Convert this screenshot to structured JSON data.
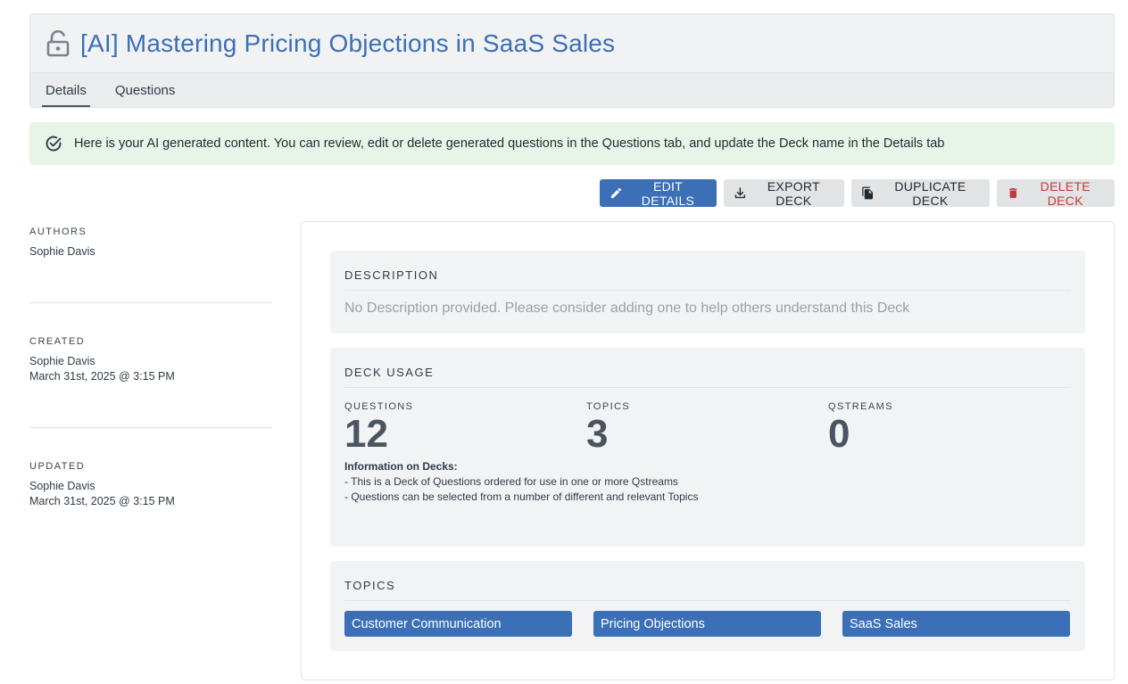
{
  "header": {
    "title": "[AI] Mastering Pricing Objections in SaaS Sales",
    "icon": "lock-open-icon"
  },
  "tabs": [
    {
      "label": "Details",
      "active": true
    },
    {
      "label": "Questions",
      "active": false
    }
  ],
  "alert": {
    "icon": "check-circle-icon",
    "text": "Here is your AI generated content. You can review, edit or delete generated questions in the Questions tab, and update the Deck name in the Details tab"
  },
  "actions": {
    "edit": {
      "label": "EDIT DETAILS",
      "icon": "pencil-icon"
    },
    "export": {
      "label": "EXPORT DECK",
      "icon": "download-icon"
    },
    "duplicate": {
      "label": "DUPLICATE DECK",
      "icon": "copy-icon"
    },
    "delete": {
      "label": "DELETE DECK",
      "icon": "trash-icon"
    }
  },
  "sidebar": {
    "authors": {
      "label": "AUTHORS",
      "name": "Sophie Davis"
    },
    "created": {
      "label": "CREATED",
      "name": "Sophie Davis",
      "date": "March 31st, 2025 @ 3:15 PM"
    },
    "updated": {
      "label": "UPDATED",
      "name": "Sophie Davis",
      "date": "March 31st, 2025 @ 3:15 PM"
    }
  },
  "description": {
    "title": "DESCRIPTION",
    "text": "No Description provided. Please consider adding one to help others understand this Deck"
  },
  "usage": {
    "title": "DECK USAGE",
    "stats": [
      {
        "label": "QUESTIONS",
        "value": "12"
      },
      {
        "label": "TOPICS",
        "value": "3"
      },
      {
        "label": "QSTREAMS",
        "value": "0"
      }
    ],
    "info_title": "Information on Decks:",
    "info_lines": [
      "- This is a Deck of Questions ordered for use in one or more Qstreams",
      "- Questions can be selected from a number of different and relevant Topics"
    ]
  },
  "topics": {
    "title": "TOPICS",
    "items": [
      "Customer Communication",
      "Pricing Objections",
      "SaaS Sales"
    ]
  },
  "colors": {
    "accent": "#3b6fb6",
    "success_bg": "#e7f4e8",
    "danger": "#c43a3a"
  }
}
